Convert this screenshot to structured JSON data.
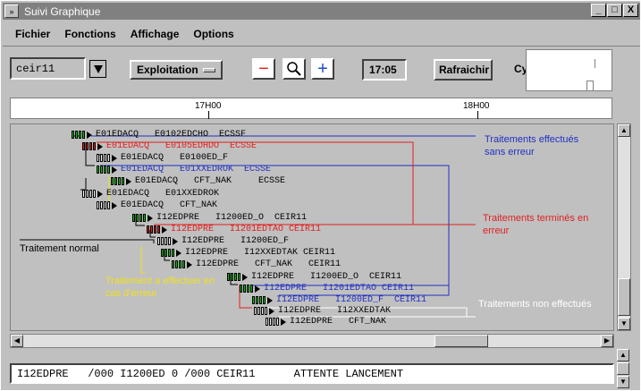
{
  "window": {
    "title": "Suivi Graphique",
    "buttons": {
      "minimize": "_",
      "maximize": "□",
      "close": "X"
    }
  },
  "menu": [
    "Fichier",
    "Fonctions",
    "Affichage",
    "Options"
  ],
  "toolbar": {
    "combo_value": "ceir11",
    "mode_label": "Exploitation",
    "zoom_out": "−",
    "zoom_in": "+",
    "clock": "17:05",
    "refresh_label": "Rafraichir",
    "cycle_label": "Cy"
  },
  "timeline": {
    "labels": [
      "17H00",
      "18H00"
    ]
  },
  "graph": {
    "nodes": [
      {
        "text": "E01EDACQ   E0102EDCHO  ECSSF",
        "color": "#000000",
        "bars": "green"
      },
      {
        "text": "E01EDACQ   E0105EDHDO  ECSSE",
        "color": "#e02020",
        "bars": "red"
      },
      {
        "text": "E01EDACQ   E0100ED_F",
        "color": "#000000",
        "bars": "white"
      },
      {
        "text": "E01EDACQ   E01XXEDROK  ECSSE",
        "color": "#2030c0",
        "bars": "green"
      },
      {
        "text": "E01EDACQ   CFT_NAK     ECSSE",
        "color": "#000000",
        "bars": "green"
      },
      {
        "text": "E01EDACQ   E01XXEDROK",
        "color": "#000000",
        "bars": "white"
      },
      {
        "text": "E01EDACQ   CFT_NAK",
        "color": "#000000",
        "bars": "white"
      },
      {
        "text": "I12EDPRE   I1200ED_O  CEIR11",
        "color": "#000000",
        "bars": "green"
      },
      {
        "text": "I12EDPRE   I1201EDTAO CEIR11",
        "color": "#e02020",
        "bars": "red"
      },
      {
        "text": "I12EDPRE   I1200ED_F",
        "color": "#000000",
        "bars": "white"
      },
      {
        "text": "I12EDPRE   I12XXEDTAK CEIR11",
        "color": "#000000",
        "bars": "green"
      },
      {
        "text": "I12EDPRE   CFT_NAK   CEIR11",
        "color": "#000000",
        "bars": "green"
      },
      {
        "text": "I12EDPRE   I1200ED_O  CEIR11",
        "color": "#000000",
        "bars": "green"
      },
      {
        "text": "I12EDPRE   I1201EDTAO CEIR11",
        "color": "#2030c0",
        "bars": "green"
      },
      {
        "text": "I12EDPRE   I1200ED_F  CEIR11",
        "color": "#2030c0",
        "bars": "green"
      },
      {
        "text": "I12EDPRE   I12XXEDTAK",
        "color": "#000000",
        "bars": "white"
      },
      {
        "text": "I12EDPRE   CFT_NAK",
        "color": "#000000",
        "bars": "white"
      }
    ],
    "annotations": {
      "done_ok": "Traitements effectués sans erreur",
      "done_err": "Traitements terminés en erreur",
      "normal": "Traitement normal",
      "on_error": "Traitement a effectuer en cas d'erreur",
      "not_done": "Traitements non effectués"
    },
    "colors": {
      "ok": "#2030c0",
      "err": "#e02020",
      "warn": "#f0e020",
      "normal": "#000000",
      "notdone": "#ffffff"
    }
  },
  "status": "I12EDPRE   /000 I1200ED 0 /000 CEIR11      ATTENTE LANCEMENT"
}
